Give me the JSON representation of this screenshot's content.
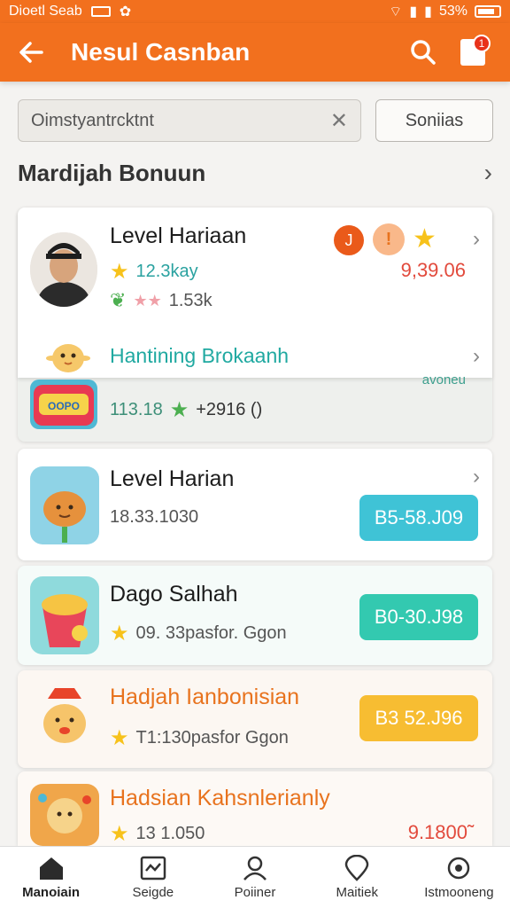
{
  "status_bar": {
    "left_text": "Dioetl Seab",
    "right_text": "53%"
  },
  "app_bar": {
    "title": "Nesul Casnban"
  },
  "notification_count": "1",
  "search": {
    "value": "Oimstyantrcktnt",
    "button_label": "Soniias"
  },
  "section": {
    "title": "Mardijah Bonuun"
  },
  "featured": {
    "title": "Level Hariaan",
    "stat1": "12.3kay",
    "stat2": "1.53k",
    "amount": "9,39.06",
    "badge1": "J",
    "badge2": "!",
    "subitem_title": "Hantining Brokaanh",
    "subitem_stats": "113.18",
    "subitem_extra": "+2916 ()",
    "subitem_tag": "avoneu"
  },
  "items": [
    {
      "title": "Level Harian",
      "subtitle": "18.33.1030",
      "price": "B5-58.J09"
    },
    {
      "title": "Dago Salhah",
      "subtitle": "09. 33pasfor. Ggon",
      "price": "B0-30.J98"
    },
    {
      "title": "Hadjah Ianbonisian",
      "subtitle": "T1:130pasfor Ggon",
      "price": "B3 52.J96"
    },
    {
      "title": "Hadsian Kahsnlerianly",
      "subtitle": "13 1.050",
      "price": "9.1800̃"
    }
  ],
  "colors": {
    "brand": "#f2701e",
    "teal": "#3fc3d6",
    "green_teal": "#33c9b0",
    "amber": "#f7bd32",
    "orange_text": "#e8731e",
    "red_text": "#e74c3c"
  },
  "nav": [
    {
      "label": "Manoiain",
      "icon": "home-icon"
    },
    {
      "label": "Seigde",
      "icon": "news-icon"
    },
    {
      "label": "Poiiner",
      "icon": "profile-icon"
    },
    {
      "label": "Maitiek",
      "icon": "location-icon"
    },
    {
      "label": "Istmooneng",
      "icon": "settings-icon"
    }
  ]
}
